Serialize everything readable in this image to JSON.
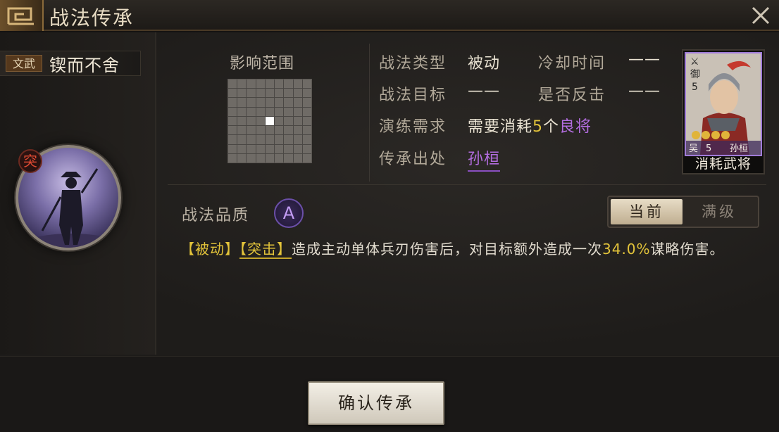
{
  "window": {
    "title": "战法传承"
  },
  "skill": {
    "type_badge": "文武",
    "name": "锲而不舍",
    "tu_badge": "突"
  },
  "range": {
    "label": "影响范围",
    "grid_size": 9,
    "active_cell": [
      4,
      4
    ]
  },
  "info": {
    "type_label": "战法类型",
    "type_value": "被动",
    "cooldown_label": "冷却时间",
    "cooldown_value": "——",
    "target_label": "战法目标",
    "target_value": "——",
    "counter_label": "是否反击",
    "counter_value": "——",
    "train_label": "演练需求",
    "train_prefix": "需要消耗",
    "train_count": "5",
    "train_unit": "个",
    "train_item": "良将",
    "source_label": "传承出处",
    "source_value": "孙桓"
  },
  "card": {
    "faction_icon": "⚔",
    "unit": "御",
    "cost": "5",
    "stars": 4,
    "kingdom": "吴",
    "level": "5",
    "hero": "孙桓",
    "caption": "消耗武将"
  },
  "quality": {
    "label": "战法品质",
    "grade": "A"
  },
  "tabs": [
    {
      "label": "当前",
      "active": true
    },
    {
      "label": "满级",
      "active": false
    }
  ],
  "description": {
    "tag1": "【被动】",
    "tag2": "【突击】",
    "text1": "造成主动单体兵刃伤害后，对目标额外造成一次",
    "percent": "34.0%",
    "text2": "谋略伤害。"
  },
  "confirm": {
    "label": "确认传承"
  },
  "colors": {
    "purple": "#b36de0",
    "yellow": "#e3c43a"
  }
}
